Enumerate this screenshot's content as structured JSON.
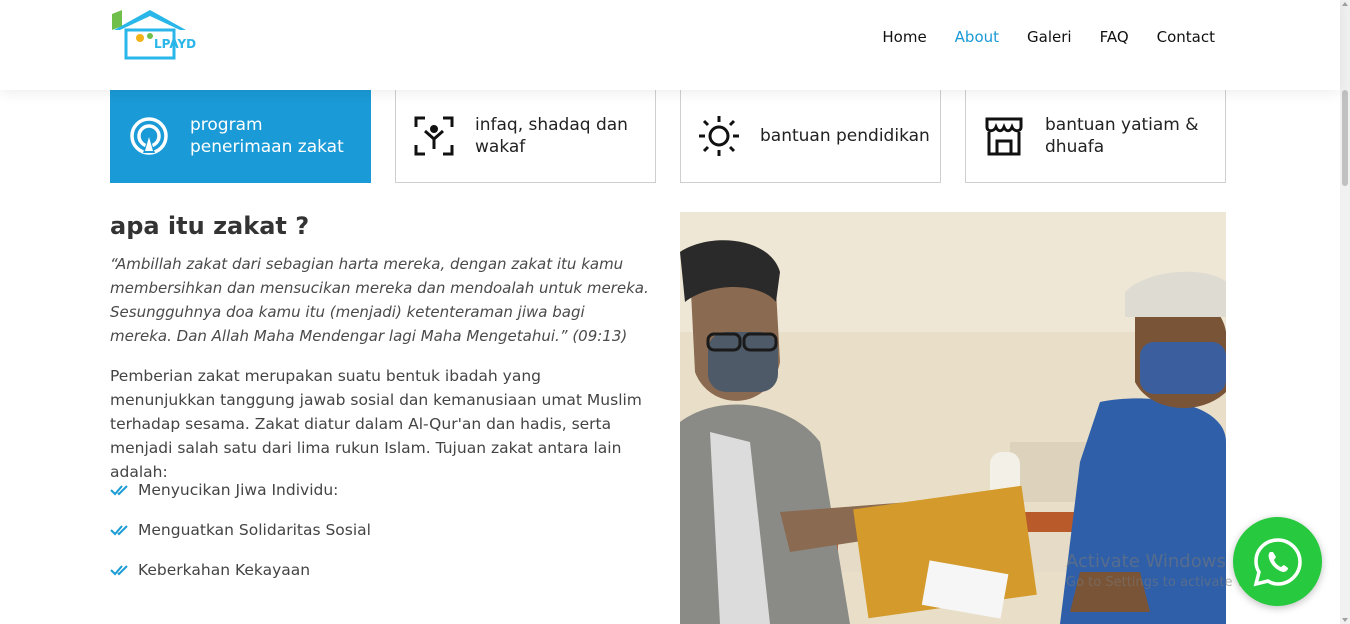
{
  "brand": {
    "logo_text": "LPAYD",
    "accent": "#1a9ad6",
    "logo_colors": [
      "#29b6e8",
      "#6fbf4a",
      "#f3b316"
    ]
  },
  "nav": {
    "items": [
      {
        "label": "Home",
        "active": false
      },
      {
        "label": "About",
        "active": true
      },
      {
        "label": "Galeri",
        "active": false
      },
      {
        "label": "FAQ",
        "active": false
      },
      {
        "label": "Contact",
        "active": false
      }
    ]
  },
  "services": [
    {
      "label": "program penerimaan zakat",
      "icon": "broadcast-icon",
      "active": true
    },
    {
      "label": "infaq, shadaq dan wakaf",
      "icon": "person-focus-icon",
      "active": false
    },
    {
      "label": "bantuan pendidikan",
      "icon": "sun-icon",
      "active": false
    },
    {
      "label": "bantuan yatiam & dhuafa",
      "icon": "store-icon",
      "active": false
    }
  ],
  "content": {
    "heading": "apa itu zakat ?",
    "quote": "“Ambillah zakat dari sebagian harta mereka, dengan zakat itu kamu membersihkan dan mensucikan mereka dan mendoalah untuk mereka. Sesungguhnya doa kamu itu (menjadi) ketenteraman jiwa bagi mereka. Dan Allah Maha Mendengar lagi Maha Mengetahui.” (09:13)",
    "paragraph": "Pemberian zakat merupakan suatu bentuk ibadah yang menunjukkan tanggung jawab sosial dan kemanusiaan umat Muslim terhadap sesama. Zakat diatur dalam Al-Qur'an dan hadis, serta menjadi salah satu dari lima rukun Islam. Tujuan zakat antara lain adalah:",
    "list": [
      "Menyucikan Jiwa Individu:",
      "Menguatkan Solidaritas Sosial",
      "Keberkahan Kekayaan"
    ]
  },
  "photo": {
    "alt": "Penyerahan amplop zakat"
  },
  "overlay": {
    "activate_title": "Activate Windows",
    "activate_sub": "Go to Settings to activate Windows."
  },
  "whatsapp": {
    "icon": "whatsapp-icon",
    "color": "#27c93f"
  }
}
